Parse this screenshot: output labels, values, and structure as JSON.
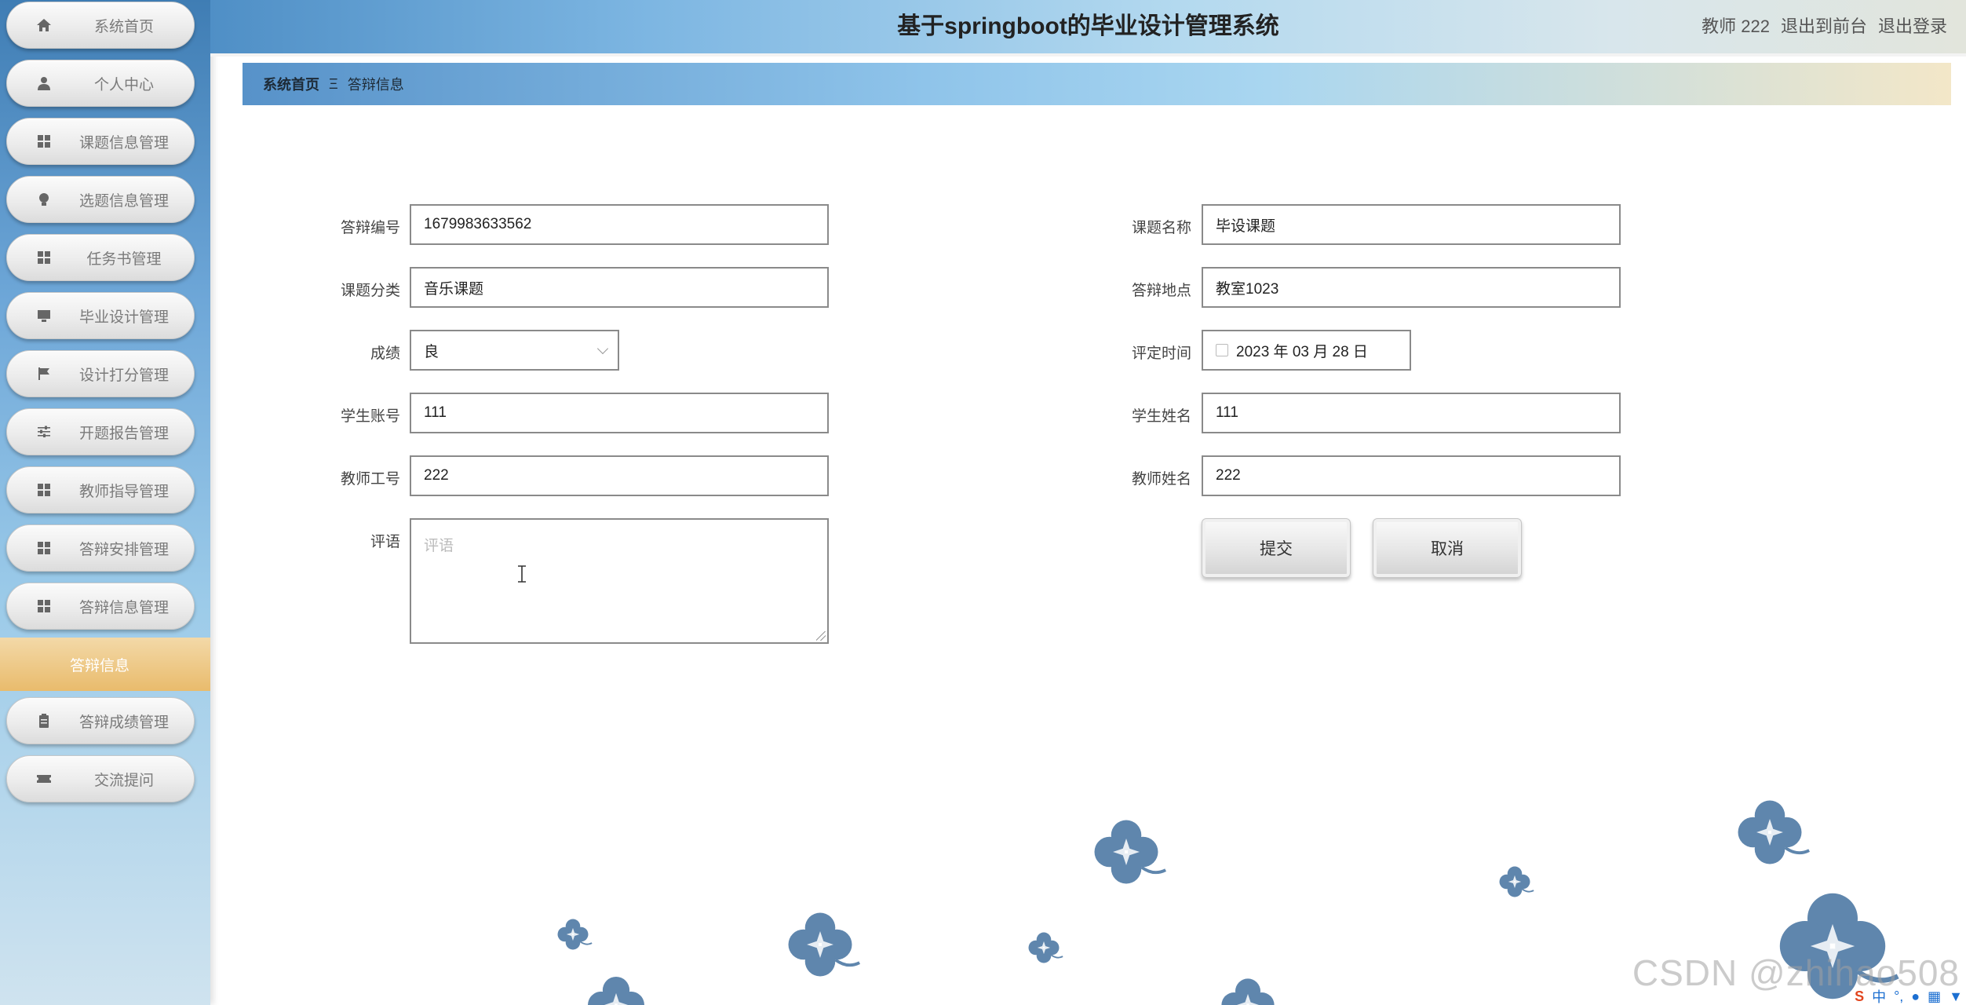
{
  "header": {
    "title": "基于springboot的毕业设计管理系统",
    "user": "教师 222",
    "front_link": "退出到前台",
    "logout_link": "退出登录"
  },
  "sidebar": {
    "items": [
      {
        "label": "系统首页",
        "icon": "home-icon"
      },
      {
        "label": "个人中心",
        "icon": "user-icon"
      },
      {
        "label": "课题信息管理",
        "icon": "grid-icon"
      },
      {
        "label": "选题信息管理",
        "icon": "bulb-icon"
      },
      {
        "label": "任务书管理",
        "icon": "grid-icon"
      },
      {
        "label": "毕业设计管理",
        "icon": "monitor-icon"
      },
      {
        "label": "设计打分管理",
        "icon": "flag-icon"
      },
      {
        "label": "开题报告管理",
        "icon": "sliders-icon"
      },
      {
        "label": "教师指导管理",
        "icon": "grid-icon"
      },
      {
        "label": "答辩安排管理",
        "icon": "grid-icon"
      },
      {
        "label": "答辩信息管理",
        "icon": "grid-icon"
      }
    ],
    "active_sub": "答辩信息",
    "items_after": [
      {
        "label": "答辩成绩管理",
        "icon": "clipboard-icon"
      },
      {
        "label": "交流提问",
        "icon": "ticket-icon"
      }
    ]
  },
  "breadcrumb": {
    "home": "系统首页",
    "separator": "Ξ",
    "current": "答辩信息"
  },
  "form": {
    "defense_no": {
      "label": "答辩编号",
      "value": "1679983633562"
    },
    "topic_name": {
      "label": "课题名称",
      "value": "毕设课题"
    },
    "topic_category": {
      "label": "课题分类",
      "value": "音乐课题"
    },
    "defense_place": {
      "label": "答辩地点",
      "value": "教室1023"
    },
    "grade": {
      "label": "成绩",
      "value": "良"
    },
    "eval_time": {
      "label": "评定时间",
      "value": "2023 年 03 月 28 日"
    },
    "student_account": {
      "label": "学生账号",
      "value": "111"
    },
    "student_name": {
      "label": "学生姓名",
      "value": "111"
    },
    "teacher_no": {
      "label": "教师工号",
      "value": "222"
    },
    "teacher_name": {
      "label": "教师姓名",
      "value": "222"
    },
    "comment": {
      "label": "评语",
      "placeholder": "评语"
    },
    "submit_label": "提交",
    "cancel_label": "取消"
  },
  "footer": {
    "watermark": "CSDN @zhihao508",
    "ime_logo": "S",
    "ime_lang": "中"
  },
  "colors": {
    "sidebar_top": "#3f7db4",
    "active_item": "#e9bb6c",
    "clover": "#5f86ad"
  }
}
